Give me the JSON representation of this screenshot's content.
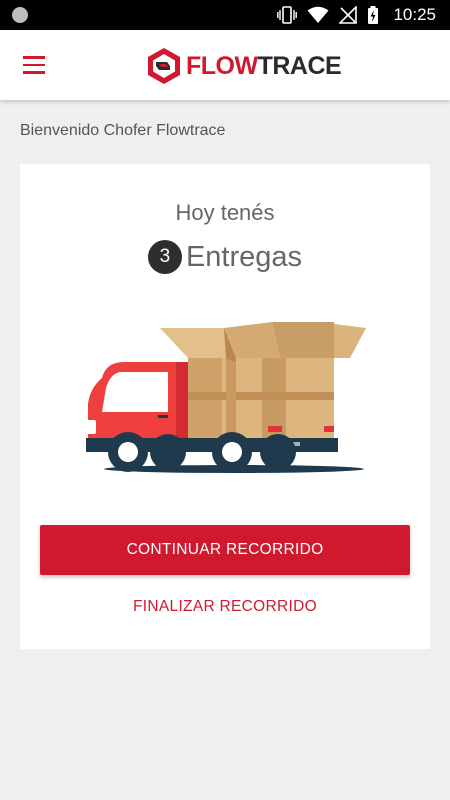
{
  "status_bar": {
    "time": "10:25",
    "icons": [
      "notification-dot-icon",
      "vibrate-icon",
      "wifi-icon",
      "no-signal-icon",
      "battery-charging-icon"
    ]
  },
  "app_bar": {
    "menu_icon": "hamburger-menu-icon",
    "logo_part1": "FLOW",
    "logo_part2": "TRACE"
  },
  "welcome_text": "Bienvenido Chofer Flowtrace",
  "summary_card": {
    "title": "Hoy tenés",
    "count": "3",
    "count_label": "Entregas",
    "illustration": "delivery-truck-icon"
  },
  "actions": {
    "continue_label": "CONTINUAR RECORRIDO",
    "finish_label": "FINALIZAR RECORRIDO"
  },
  "colors": {
    "brand_red": "#d0192f",
    "status_bar": "#000000",
    "background": "#efefef",
    "text_gray": "#666666"
  }
}
